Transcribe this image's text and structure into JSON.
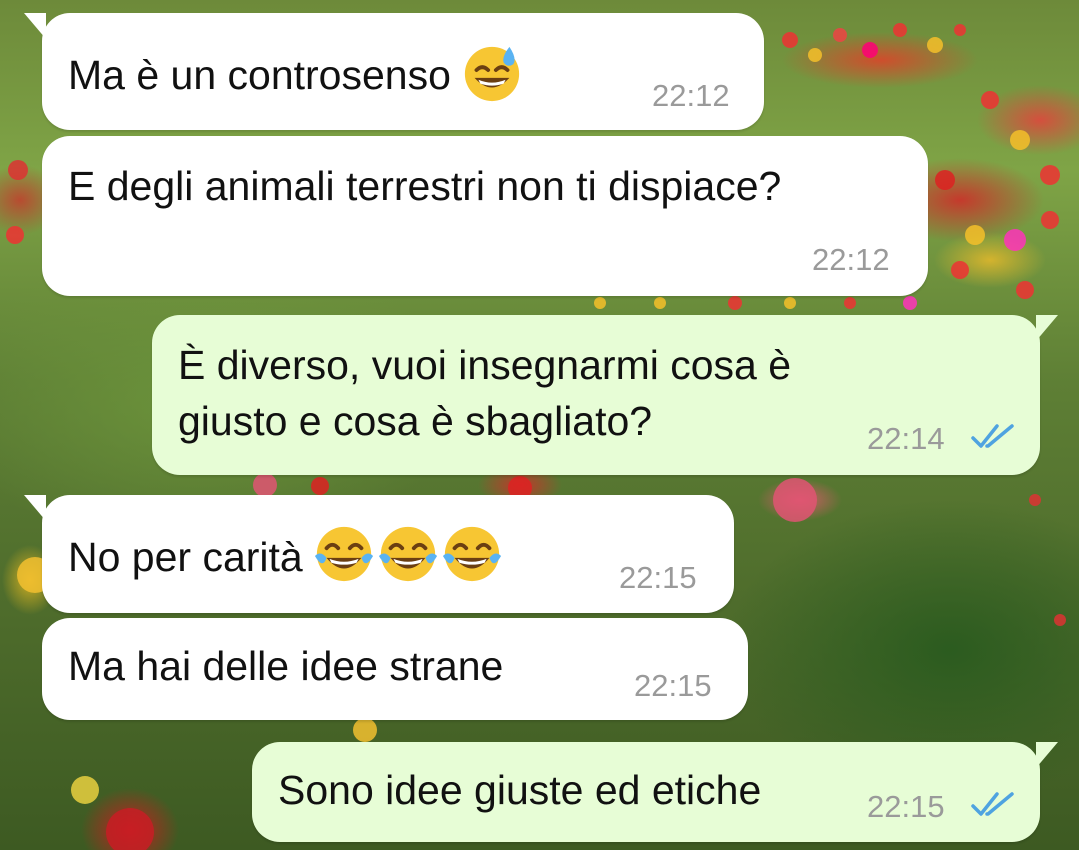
{
  "messages": [
    {
      "direction": "in",
      "text": "Ma è un controsenso",
      "emoji": [
        "sweat-smile"
      ],
      "time": "22:12"
    },
    {
      "direction": "in",
      "text": "E degli animali terrestri non ti dispiace?",
      "time": "22:12"
    },
    {
      "direction": "out",
      "lines": [
        "È diverso, vuoi insegnarmi cosa è",
        "giusto e cosa è sbagliato?"
      ],
      "time": "22:14",
      "status": "read"
    },
    {
      "direction": "in",
      "text": "No per carità",
      "emoji": [
        "tears-of-joy",
        "tears-of-joy",
        "tears-of-joy"
      ],
      "time": "22:15"
    },
    {
      "direction": "in",
      "text": "Ma hai delle idee strane",
      "time": "22:15"
    },
    {
      "direction": "out",
      "text": "Sono idee giuste ed etiche",
      "time": "22:15",
      "status": "read"
    }
  ],
  "colors": {
    "incoming_bubble": "#ffffff",
    "outgoing_bubble": "#e7fdd6",
    "timestamp": "#9a9a9a",
    "read_ticks": "#4fa3e0"
  },
  "icons": {
    "read_receipt": "double-check-icon",
    "background": "tulip-field-wallpaper"
  }
}
